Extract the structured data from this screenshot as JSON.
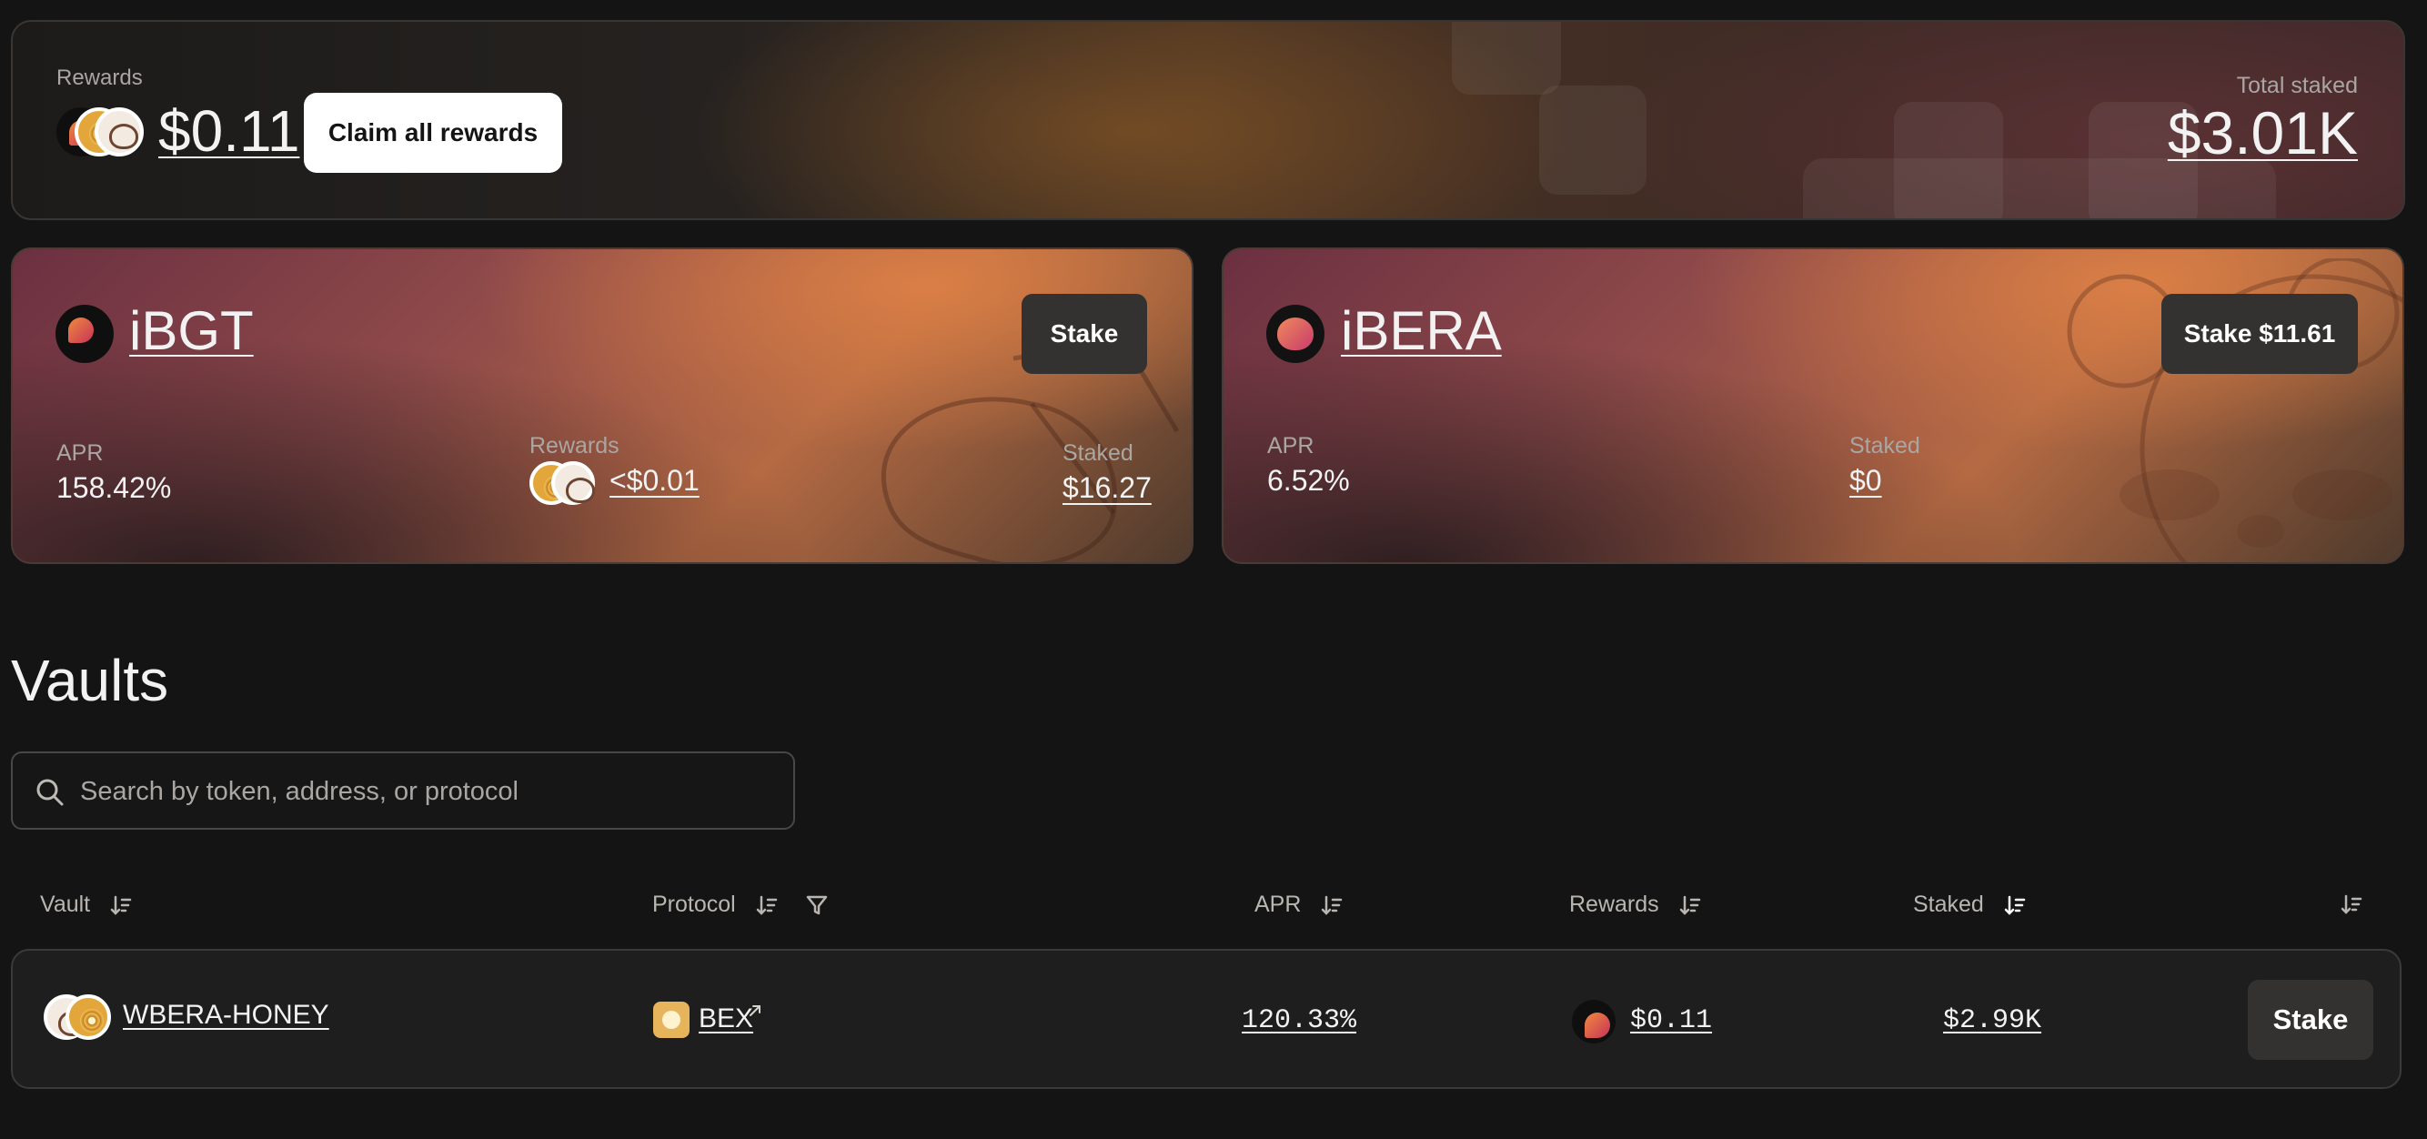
{
  "summary": {
    "rewards_label": "Rewards",
    "rewards_value": "$0.11",
    "claim_button": "Claim all rewards",
    "total_staked_label": "Total staked",
    "total_staked_value": "$3.01K"
  },
  "ibgt_card": {
    "name": "iBGT",
    "stake_button": "Stake",
    "apr_label": "APR",
    "apr_value": "158.42%",
    "rewards_label": "Rewards",
    "rewards_value": "<$0.01",
    "staked_label": "Staked",
    "staked_value": "$16.27"
  },
  "ibera_card": {
    "name": "iBERA",
    "stake_button": "Stake $11.61",
    "apr_label": "APR",
    "apr_value": "6.52%",
    "staked_label": "Staked",
    "staked_value": "$0"
  },
  "vaults": {
    "title": "Vaults",
    "search_placeholder": "Search by token, address, or protocol",
    "columns": {
      "vault": "Vault",
      "protocol": "Protocol",
      "apr": "APR",
      "rewards": "Rewards",
      "staked": "Staked"
    },
    "rows": [
      {
        "vault": "WBERA-HONEY",
        "protocol": "BEX",
        "apr": "120.33%",
        "rewards": "$0.11",
        "staked": "$2.99K",
        "action": "Stake"
      }
    ]
  },
  "colors": {
    "background": "#141414",
    "accent_orange": "#c9753f",
    "accent_plum": "#6b3041",
    "button_dark": "#333231"
  },
  "icons": [
    "bgt-token-icon",
    "honey-token-icon",
    "bera-token-icon",
    "search-icon",
    "sort-icon",
    "filter-icon",
    "external-link-icon"
  ]
}
